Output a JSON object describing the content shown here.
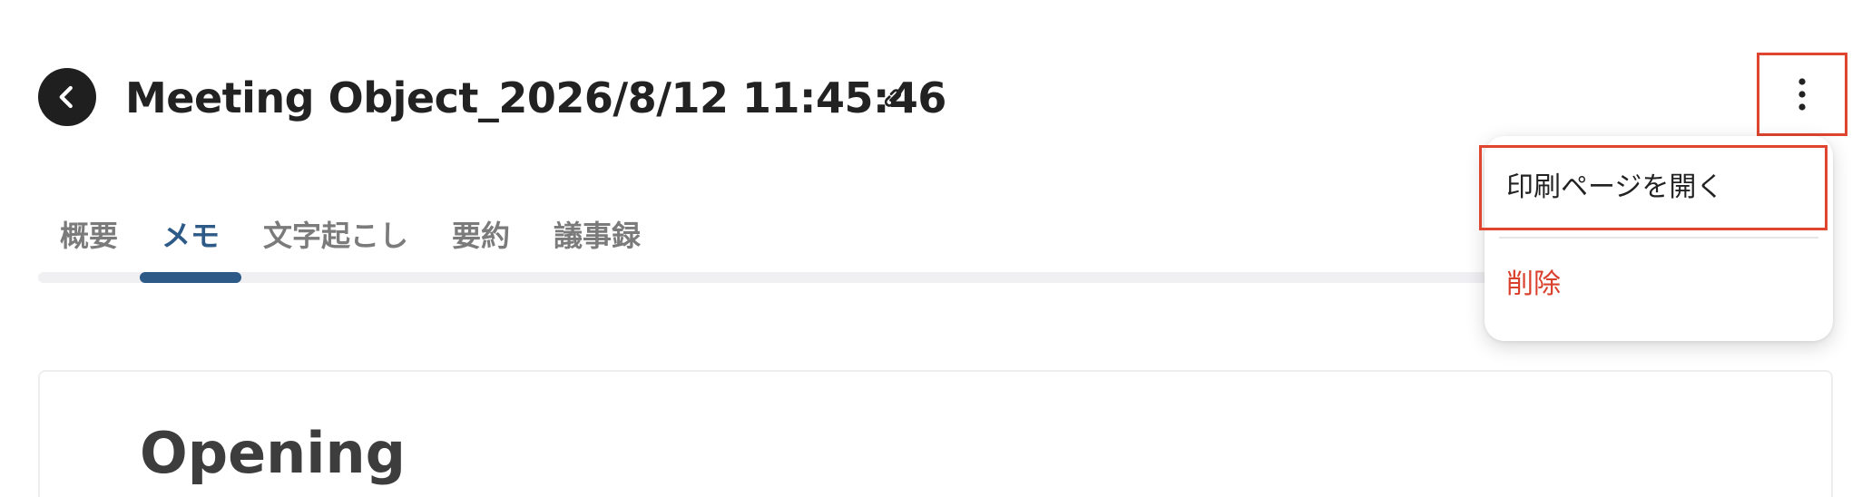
{
  "header": {
    "title": "Meeting Object_2026/8/12 11:45:46"
  },
  "tabs": [
    {
      "label": "概要",
      "active": false
    },
    {
      "label": "メモ",
      "active": true
    },
    {
      "label": "文字起こし",
      "active": false
    },
    {
      "label": "要約",
      "active": false
    },
    {
      "label": "議事録",
      "active": false
    }
  ],
  "menu": {
    "print_label": "印刷ページを開く",
    "delete_label": "削除"
  },
  "content": {
    "heading": "Opening"
  },
  "colors": {
    "accent": "#2d5a86",
    "danger": "#d9412c",
    "highlight": "#e0452f"
  },
  "icons": {
    "back": "chevron-left-icon",
    "link": "link-icon",
    "more": "more-vertical-icon"
  }
}
